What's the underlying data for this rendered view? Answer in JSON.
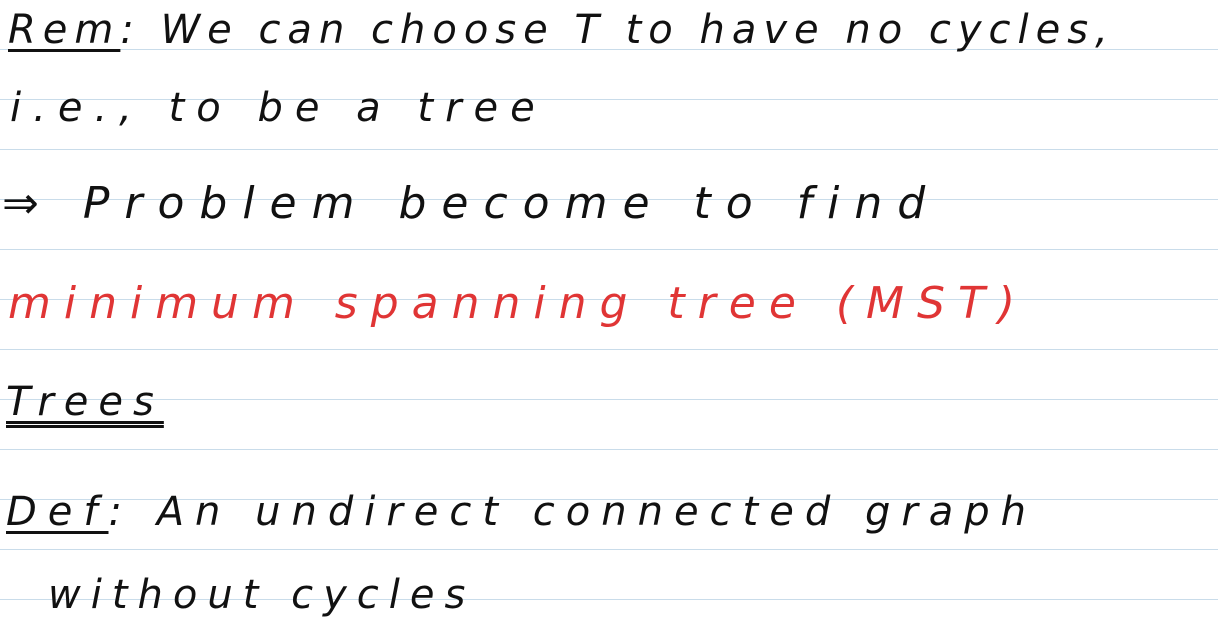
{
  "note": {
    "line_1": {
      "label": "Rem",
      "text": ": We can choose T to have no cycles,"
    },
    "line_2": {
      "text": "i.e., to be a tree"
    },
    "line_3": {
      "arrow": "⇒",
      "text": " Problem become to find"
    },
    "line_4": {
      "text": "minimum spanning tree (MST)"
    },
    "line_5": {
      "heading": "Trees"
    },
    "line_6": {
      "label": "Def",
      "text": ": An undirect connected graph"
    },
    "line_7": {
      "text": "without cycles"
    }
  },
  "colors": {
    "ink": "#111111",
    "highlight": "#e03535",
    "rule_line": "#c9dcea",
    "paper": "#ffffff"
  }
}
